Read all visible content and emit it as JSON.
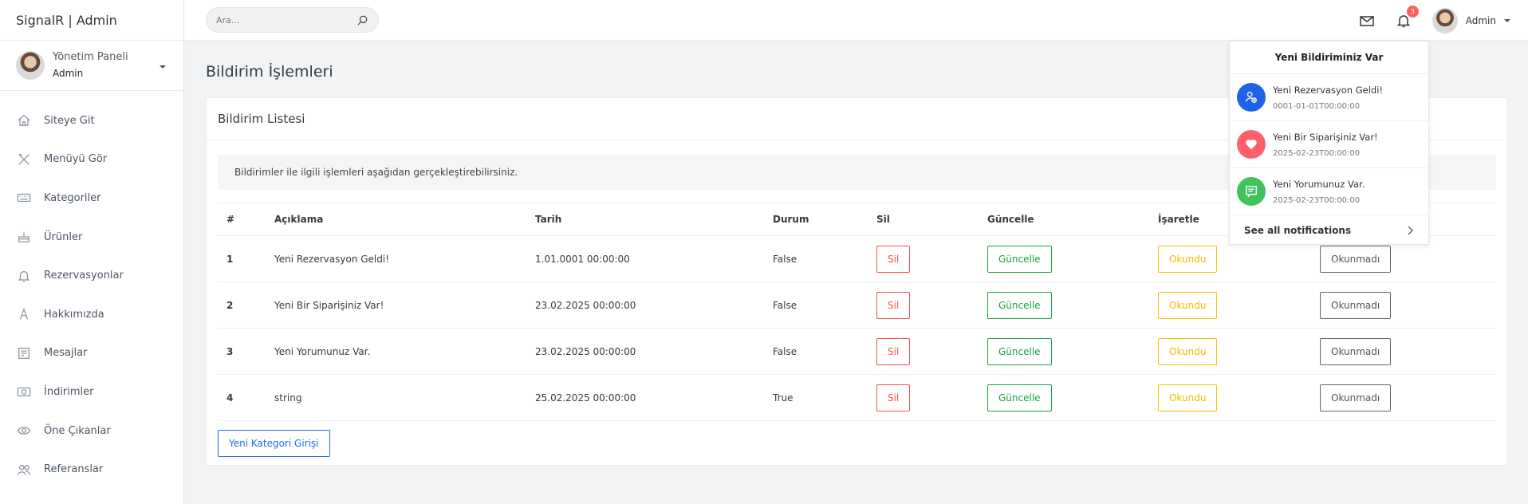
{
  "app": {
    "brand": "SignalR | Admin"
  },
  "profile": {
    "title": "Yönetim Paneli",
    "role": "Admin"
  },
  "sidebar": {
    "items": [
      {
        "label": "Siteye Git",
        "icon": "home-icon"
      },
      {
        "label": "Menüyü Gör",
        "icon": "utensils-icon"
      },
      {
        "label": "Kategoriler",
        "icon": "keyboard-icon"
      },
      {
        "label": "Ürünler",
        "icon": "cake-icon"
      },
      {
        "label": "Rezervasyonlar",
        "icon": "bell-icon"
      },
      {
        "label": "Hakkımızda",
        "icon": "font-icon"
      },
      {
        "label": "Mesajlar",
        "icon": "inbox-icon"
      },
      {
        "label": "İndirimler",
        "icon": "money-icon"
      },
      {
        "label": "Öne Çıkanlar",
        "icon": "eye-icon"
      },
      {
        "label": "Referanslar",
        "icon": "users-icon"
      }
    ]
  },
  "topbar": {
    "search_placeholder": "Ara...",
    "notification_count": "3",
    "user_name": "Admin"
  },
  "main": {
    "page_title": "Bildirim İşlemleri",
    "card_title": "Bildirim Listesi",
    "info_text": "Bildirimler ile ilgili işlemleri aşağıdan gerçekleştirebilirsiniz.",
    "table": {
      "headers": [
        "#",
        "Açıklama",
        "Tarih",
        "Durum",
        "Sil",
        "Güncelle",
        "İşaretle",
        ""
      ],
      "rows": [
        {
          "id": "1",
          "description": "Yeni Rezervasyon Geldi!",
          "date": "1.01.0001 00:00:00",
          "status": "False"
        },
        {
          "id": "2",
          "description": "Yeni Bir Siparişiniz Var!",
          "date": "23.02.2025 00:00:00",
          "status": "False"
        },
        {
          "id": "3",
          "description": "Yeni Yorumunuz Var.",
          "date": "23.02.2025 00:00:00",
          "status": "False"
        },
        {
          "id": "4",
          "description": "string",
          "date": "25.02.2025 00:00:00",
          "status": "True"
        }
      ],
      "buttons": {
        "delete": "Sil",
        "update": "Güncelle",
        "read": "Okundu",
        "unread": "Okunmadı"
      }
    },
    "new_button": "Yeni Kategori Girişi"
  },
  "notifications": {
    "header": "Yeni Bildiriminiz Var",
    "items": [
      {
        "title": "Yeni Rezervasyon Geldi!",
        "time": "0001-01-01T00:00:00",
        "color": "#1e62e8",
        "icon": "user-plus-icon"
      },
      {
        "title": "Yeni Bir Siparişiniz Var!",
        "time": "2025-02-23T00:00:00",
        "color": "#ff5f6d",
        "icon": "heart-icon"
      },
      {
        "title": "Yeni Yorumunuz Var.",
        "time": "2025-02-23T00:00:00",
        "color": "#3fc35a",
        "icon": "comment-icon"
      }
    ],
    "footer": "See all notifications"
  }
}
